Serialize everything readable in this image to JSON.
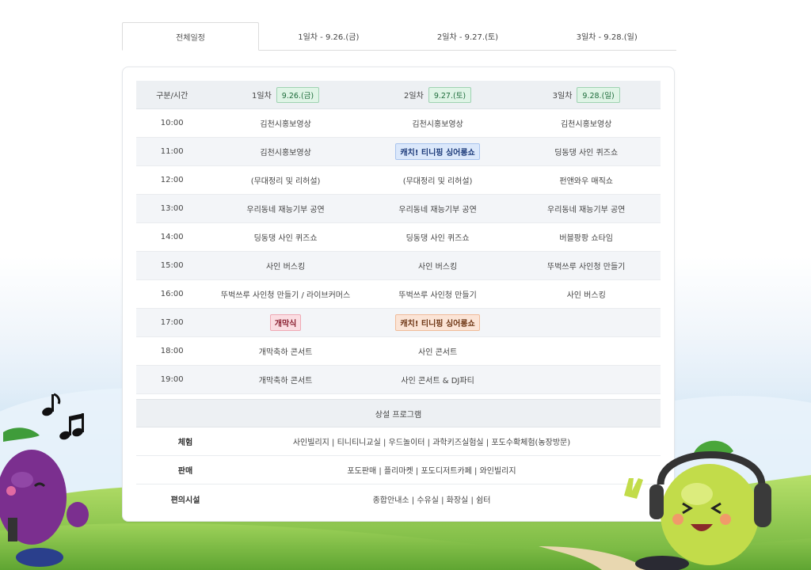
{
  "tabs": [
    {
      "label": "전체일정",
      "active": true
    },
    {
      "label": "1일차 - 9.26.(금)",
      "active": false
    },
    {
      "label": "2일차 - 9.27.(토)",
      "active": false
    },
    {
      "label": "3일차 - 9.28.(일)",
      "active": false
    }
  ],
  "schedule": {
    "header": {
      "col0": "구분/시간",
      "days": [
        {
          "label": "1일차",
          "date": "9.26.(금)"
        },
        {
          "label": "2일차",
          "date": "9.27.(토)"
        },
        {
          "label": "3일차",
          "date": "9.28.(일)"
        }
      ]
    },
    "rows": [
      {
        "time": "10:00",
        "d1": "김천시홍보영상",
        "d2": "김천시홍보영상",
        "d3": "김천시홍보영상"
      },
      {
        "time": "11:00",
        "d1": "김천시홍보영상",
        "d2": "캐치! 티니핑 싱어롱쇼",
        "d3": "딩동댕 사인 퀴즈쇼"
      },
      {
        "time": "12:00",
        "d1": "(무대정리 및 리허설)",
        "d2": "(무대정리 및 리허설)",
        "d3": "펀앤와우 매직쇼"
      },
      {
        "time": "13:00",
        "d1": "우리동네 재능기부 공연",
        "d2": "우리동네 재능기부 공연",
        "d3": "우리동네 재능기부 공연"
      },
      {
        "time": "14:00",
        "d1": "딩동댕 사인 퀴즈쇼",
        "d2": "딩동댕 사인 퀴즈쇼",
        "d3": "버블팡팡 쇼타임"
      },
      {
        "time": "15:00",
        "d1": "사인 버스킹",
        "d2": "사인 버스킹",
        "d3": "뚜벅쓰루 사인청 만들기"
      },
      {
        "time": "16:00",
        "d1": "뚜벅쓰루 사인청 만들기 / 라이브커머스",
        "d2": "뚜벅쓰루 사인청 만들기",
        "d3": "사인 버스킹"
      },
      {
        "time": "17:00",
        "d1": "개막식",
        "d2": "캐치! 티니핑 싱어롱쇼",
        "d3": ""
      },
      {
        "time": "18:00",
        "d1": "개막축하 콘서트",
        "d2": "사인 콘서트",
        "d3": ""
      },
      {
        "time": "19:00",
        "d1": "개막축하 콘서트",
        "d2": "사인 콘서트 & DJ파티",
        "d3": ""
      }
    ]
  },
  "programs": {
    "title": "상설 프로그램",
    "rows": [
      {
        "key": "체험",
        "value": "사인빌리지 | 티니티니교실 | 우드놀이터 | 과학키즈실험실 | 포도수확체험(농장방문)"
      },
      {
        "key": "판매",
        "value": "포도판매 | 플리마켓 | 포도디저트카페 | 와인빌리지"
      },
      {
        "key": "편의시설",
        "value": "종합안내소 | 수유실 | 화장실 | 쉼터"
      }
    ]
  },
  "colors": {
    "date_badge_bg": "#dff4e6",
    "badge_blue": "#dbe8fb",
    "badge_pink": "#fbdde2",
    "badge_peach": "#fbe4d6"
  },
  "icons": [
    "music-note-icon",
    "grape-character-left",
    "grape-character-right-dj"
  ]
}
